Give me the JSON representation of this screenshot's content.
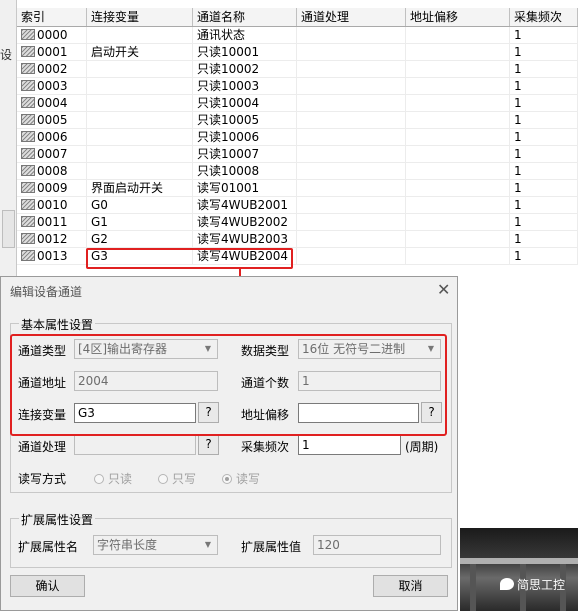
{
  "table": {
    "headers": [
      "索引",
      "连接变量",
      "通道名称",
      "通道处理",
      "地址偏移",
      "采集频次"
    ],
    "rows": [
      [
        "0000",
        "",
        "通讯状态",
        "",
        "",
        "1"
      ],
      [
        "0001",
        "启动开关",
        "只读10001",
        "",
        "",
        "1"
      ],
      [
        "0002",
        "",
        "只读10002",
        "",
        "",
        "1"
      ],
      [
        "0003",
        "",
        "只读10003",
        "",
        "",
        "1"
      ],
      [
        "0004",
        "",
        "只读10004",
        "",
        "",
        "1"
      ],
      [
        "0005",
        "",
        "只读10005",
        "",
        "",
        "1"
      ],
      [
        "0006",
        "",
        "只读10006",
        "",
        "",
        "1"
      ],
      [
        "0007",
        "",
        "只读10007",
        "",
        "",
        "1"
      ],
      [
        "0008",
        "",
        "只读10008",
        "",
        "",
        "1"
      ],
      [
        "0009",
        "界面启动开关",
        "读写01001",
        "",
        "",
        "1"
      ],
      [
        "0010",
        "G0",
        "读写4WUB2001",
        "",
        "",
        "1"
      ],
      [
        "0011",
        "G1",
        "读写4WUB2002",
        "",
        "",
        "1"
      ],
      [
        "0012",
        "G2",
        "读写4WUB2003",
        "",
        "",
        "1"
      ],
      [
        "0013",
        "G3",
        "读写4WUB2004",
        "",
        "",
        "1"
      ]
    ]
  },
  "left_strip_glyph": "设",
  "dialog": {
    "title": "编辑设备通道",
    "close_glyph": "✕",
    "basic_group": "基本属性设置",
    "channel_type_label": "通道类型",
    "channel_type_value": "[4区]输出寄存器",
    "data_type_label": "数据类型",
    "data_type_value": "16位 无符号二进制",
    "channel_addr_label": "通道地址",
    "channel_addr_value": "2004",
    "channel_count_label": "通道个数",
    "channel_count_value": "1",
    "link_var_label": "连接变量",
    "link_var_value": "G3",
    "addr_offset_label": "地址偏移",
    "addr_offset_value": "",
    "channel_proc_label": "通道处理",
    "channel_proc_value": "",
    "freq_label": "采集频次",
    "freq_value": "1",
    "freq_unit": "(周期)",
    "q_glyph": "?",
    "rw_label": "读写方式",
    "rw_options": [
      "只读",
      "只写",
      "读写"
    ],
    "rw_selected": "读写",
    "ext_group": "扩展属性设置",
    "ext_name_label": "扩展属性名",
    "ext_name_value": "字符串长度",
    "ext_value_label": "扩展属性值",
    "ext_value_value": "120",
    "ok_label": "确认",
    "cancel_label": "取消"
  },
  "watermark": "简思工控",
  "colors": {
    "highlight": "#e02020"
  }
}
